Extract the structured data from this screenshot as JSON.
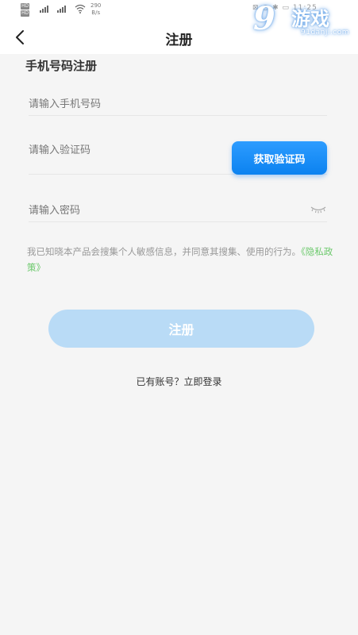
{
  "status_bar": {
    "hd_top": "HD",
    "hd_bottom": "HD",
    "net_speed_value": "290",
    "net_speed_unit": "B/s",
    "right_text": "⊠ ◷ ✱ ▭ 11:25"
  },
  "nav": {
    "title": "注册",
    "back_icon": "chevron-left-icon"
  },
  "watermark": {
    "logo": "9",
    "text": "游戏",
    "sub": "91danji.com"
  },
  "form": {
    "section_title": "手机号码注册",
    "phone_placeholder": "请输入手机号码",
    "code_placeholder": "请输入验证码",
    "get_code_label": "获取验证码",
    "password_placeholder": "请输入密码",
    "eye_icon": "eye-closed-icon"
  },
  "agreement": {
    "text": "我已知晓本产品会搜集个人敏感信息，并同意其搜集、使用的行为。",
    "policy_link": "《隐私政策》"
  },
  "register_label": "注册",
  "login_link": "已有账号？立即登录",
  "colors": {
    "primary": "#0b82f0",
    "register_disabled": "#b9dbf6",
    "policy_link": "#6cc96c",
    "background": "#f5f5f5"
  }
}
